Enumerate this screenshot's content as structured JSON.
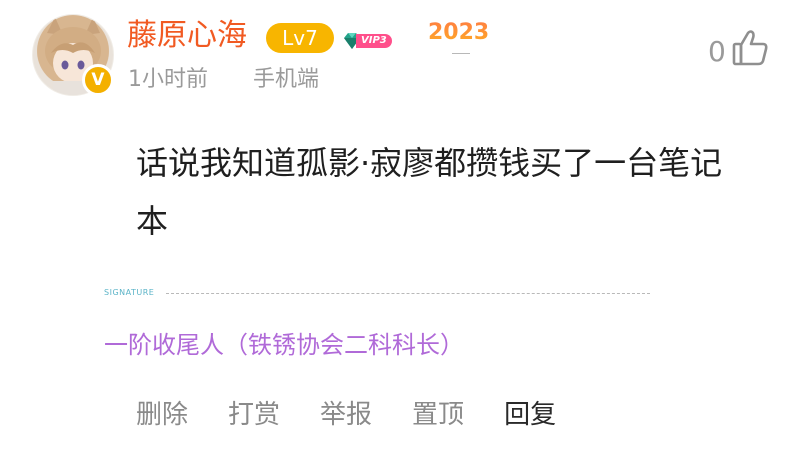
{
  "user": {
    "name": "藤原心海",
    "level": "Lv7",
    "vip": "VIP3",
    "year_badge": "2023",
    "verified_symbol": "V"
  },
  "meta": {
    "time": "1小时前",
    "device": "手机端"
  },
  "like": {
    "count": "0",
    "icon": "thumbs-up-icon"
  },
  "post": {
    "content": "话说我知道孤影·寂廖都攒钱买了一台笔记本"
  },
  "signature": {
    "label": "SIGNATURE",
    "text": "一阶收尾人（铁锈协会二科科长）"
  },
  "actions": {
    "delete": "删除",
    "tip": "打赏",
    "report": "举报",
    "pin": "置顶",
    "reply": "回复"
  },
  "colors": {
    "username": "#f15a22",
    "level_badge": "#f8b500",
    "signature_text": "#b06ad8",
    "signature_label": "#5cb4c8",
    "muted": "#9a9a9a"
  }
}
